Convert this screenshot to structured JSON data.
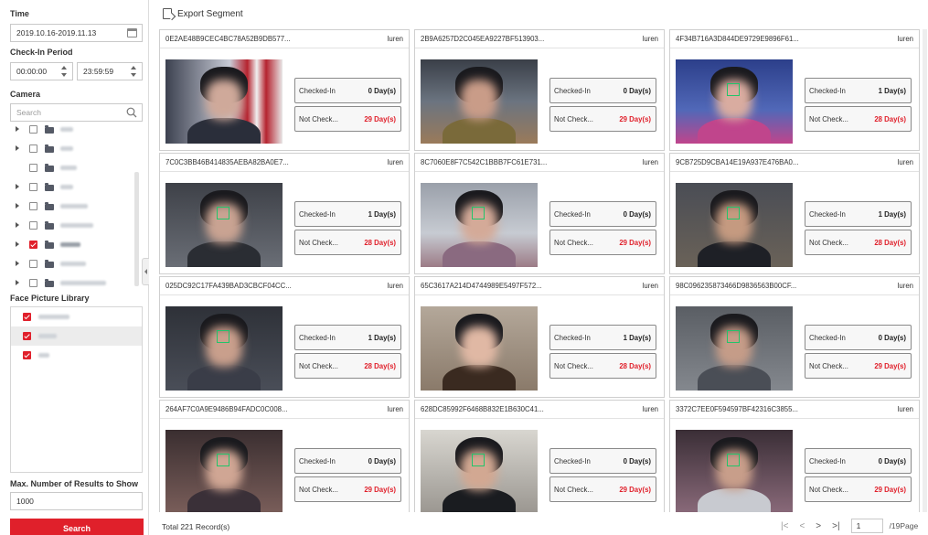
{
  "sidebar": {
    "time_label": "Time",
    "time_value": "2019.10.16-2019.11.13",
    "checkin_period_label": "Check-In Period",
    "period_start": "00:00:00",
    "period_end": "23:59:59",
    "camera_label": "Camera",
    "search_placeholder": "Search",
    "face_library_label": "Face Picture Library",
    "max_results_label": "Max. Number of Results to Show",
    "max_results_value": "1000",
    "search_button": "Search"
  },
  "toolbar": {
    "export_label": "Export Segment"
  },
  "cards": [
    {
      "id": "0E2AE48B9CEC4BC78A52B9DB577...",
      "name": "luren",
      "checked_label": "Checked-In",
      "checked_days": "0 Day(s)",
      "not_label": "Not Check...",
      "not_days": "29 Day(s)"
    },
    {
      "id": "2B9A6257D2C045EA9227BF513903...",
      "name": "luren",
      "checked_label": "Checked-In",
      "checked_days": "0 Day(s)",
      "not_label": "Not Check...",
      "not_days": "29 Day(s)"
    },
    {
      "id": "4F34B716A3D844DE9729E9896F61...",
      "name": "luren",
      "checked_label": "Checked-In",
      "checked_days": "1 Day(s)",
      "not_label": "Not Check...",
      "not_days": "28 Day(s)"
    },
    {
      "id": "7C0C3BB46B414835AEBA82BA0E7...",
      "name": "luren",
      "checked_label": "Checked-In",
      "checked_days": "1 Day(s)",
      "not_label": "Not Check...",
      "not_days": "28 Day(s)"
    },
    {
      "id": "8C7060E8F7C542C1BBB7FC61E731...",
      "name": "luren",
      "checked_label": "Checked-In",
      "checked_days": "0 Day(s)",
      "not_label": "Not Check...",
      "not_days": "29 Day(s)"
    },
    {
      "id": "9CB725D9CBA14E19A937E476BA0...",
      "name": "luren",
      "checked_label": "Checked-In",
      "checked_days": "1 Day(s)",
      "not_label": "Not Check...",
      "not_days": "28 Day(s)"
    },
    {
      "id": "025DC92C17FA439BAD3CBCF04CC...",
      "name": "luren",
      "checked_label": "Checked-In",
      "checked_days": "1 Day(s)",
      "not_label": "Not Check...",
      "not_days": "28 Day(s)"
    },
    {
      "id": "65C3617A214D4744989E5497F572...",
      "name": "luren",
      "checked_label": "Checked-In",
      "checked_days": "1 Day(s)",
      "not_label": "Not Check...",
      "not_days": "28 Day(s)"
    },
    {
      "id": "98C096235873466D9836563B00CF...",
      "name": "luren",
      "checked_label": "Checked-In",
      "checked_days": "0 Day(s)",
      "not_label": "Not Check...",
      "not_days": "29 Day(s)"
    },
    {
      "id": "264AF7C0A9E9486B94FADC0C008...",
      "name": "luren",
      "checked_label": "Checked-In",
      "checked_days": "0 Day(s)",
      "not_label": "Not Check...",
      "not_days": "29 Day(s)"
    },
    {
      "id": "628DC85992F6468B832E1B630C41...",
      "name": "luren",
      "checked_label": "Checked-In",
      "checked_days": "0 Day(s)",
      "not_label": "Not Check...",
      "not_days": "29 Day(s)"
    },
    {
      "id": "3372C7EE0F594597BF42316C3855...",
      "name": "luren",
      "checked_label": "Checked-In",
      "checked_days": "0 Day(s)",
      "not_label": "Not Check...",
      "not_days": "29 Day(s)"
    }
  ],
  "footer": {
    "total_records": "Total 221 Record(s)",
    "first_icon": "first-page-icon",
    "prev_icon": "prev-page-icon",
    "next_icon": "next-page-icon",
    "last_icon": "last-page-icon",
    "current_page": "1",
    "page_total": "/19Page"
  },
  "colors": {
    "accent": "#e0202b",
    "border": "#cfcfcf",
    "face_box": "#22c46a"
  }
}
